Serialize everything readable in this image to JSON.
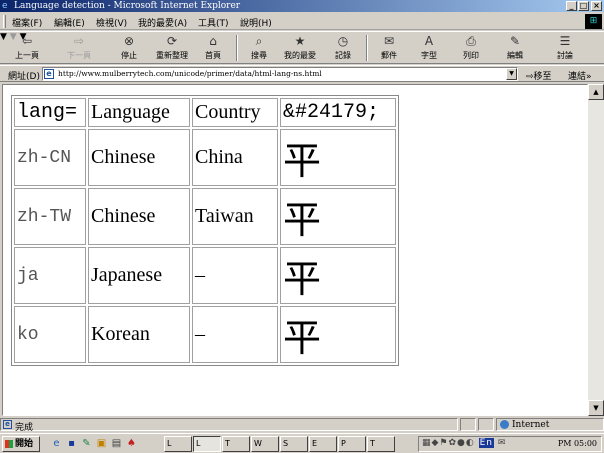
{
  "window": {
    "title": "Language detection - Microsoft Internet Explorer"
  },
  "menu": [
    "檔案(F)",
    "編輯(E)",
    "檢視(V)",
    "我的最愛(A)",
    "工具(T)",
    "說明(H)"
  ],
  "toolbar": {
    "back": "上一頁",
    "forward": "下一頁",
    "stop": "停止",
    "refresh": "重新整理",
    "home": "首頁",
    "search": "搜尋",
    "favorites": "我的最愛",
    "history": "記錄",
    "mail": "郵件",
    "font": "字型",
    "print": "列印",
    "edit": "編輯",
    "discuss": "討論"
  },
  "address": {
    "label": "網址(D)",
    "url": "http://www.mulberrytech.com/unicode/primer/data/html-lang-ns.html",
    "go": "移至",
    "links": "連結"
  },
  "table": {
    "headers": [
      "lang=",
      "Language",
      "Country",
      "&#24179;"
    ],
    "rows": [
      {
        "code": "zh-CN",
        "language": "Chinese",
        "country": "China",
        "char": "平"
      },
      {
        "code": "zh-TW",
        "language": "Chinese",
        "country": "Taiwan",
        "char": "平"
      },
      {
        "code": "ja",
        "language": "Japanese",
        "country": "–",
        "char": "平"
      },
      {
        "code": "ko",
        "language": "Korean",
        "country": "–",
        "char": "平"
      }
    ]
  },
  "status": {
    "text": "完成",
    "zone": "Internet"
  },
  "taskbar": {
    "start": "開始",
    "tasks": [
      "L",
      "L",
      "T",
      "W",
      "S",
      "E",
      "P",
      "T"
    ],
    "clock": "PM 05:00",
    "ime": "En"
  },
  "icons": {
    "back": "back-arrow-icon",
    "forward": "forward-arrow-icon",
    "stop": "stop-icon",
    "refresh": "refresh-icon",
    "home": "home-icon",
    "search": "search-icon",
    "favorites": "favorites-icon",
    "history": "history-icon",
    "mail": "mail-icon",
    "font": "font-icon",
    "print": "print-icon",
    "edit": "edit-icon",
    "discuss": "discuss-icon"
  }
}
